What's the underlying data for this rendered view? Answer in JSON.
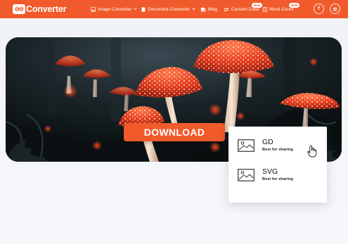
{
  "brand": {
    "badge": "ƏƏ",
    "name": "Converter"
  },
  "nav": {
    "items": [
      {
        "label": "Image Converter",
        "icon": "image-icon",
        "has_dropdown": true
      },
      {
        "label": "Document Converter",
        "icon": "document-icon",
        "has_dropdown": true
      },
      {
        "label": "Blog",
        "icon": "blog-icon"
      },
      {
        "label": "Convert Case",
        "icon": "convert-case-icon",
        "badge": "New"
      },
      {
        "label": "Word Count",
        "icon": "word-count-icon",
        "badge": "New"
      }
    ],
    "social": [
      "f",
      "◎"
    ]
  },
  "banner": {
    "download_label": "DOWNLOAD"
  },
  "dropdown": {
    "items": [
      {
        "title": "GD",
        "subtitle": "Best for sharing",
        "icon": "image-file-icon"
      },
      {
        "title": "SVG",
        "subtitle": "Best for sharing",
        "icon": "image-file-icon"
      }
    ]
  },
  "colors": {
    "accent": "#f15a2b",
    "mushroom": "#e8462a"
  }
}
